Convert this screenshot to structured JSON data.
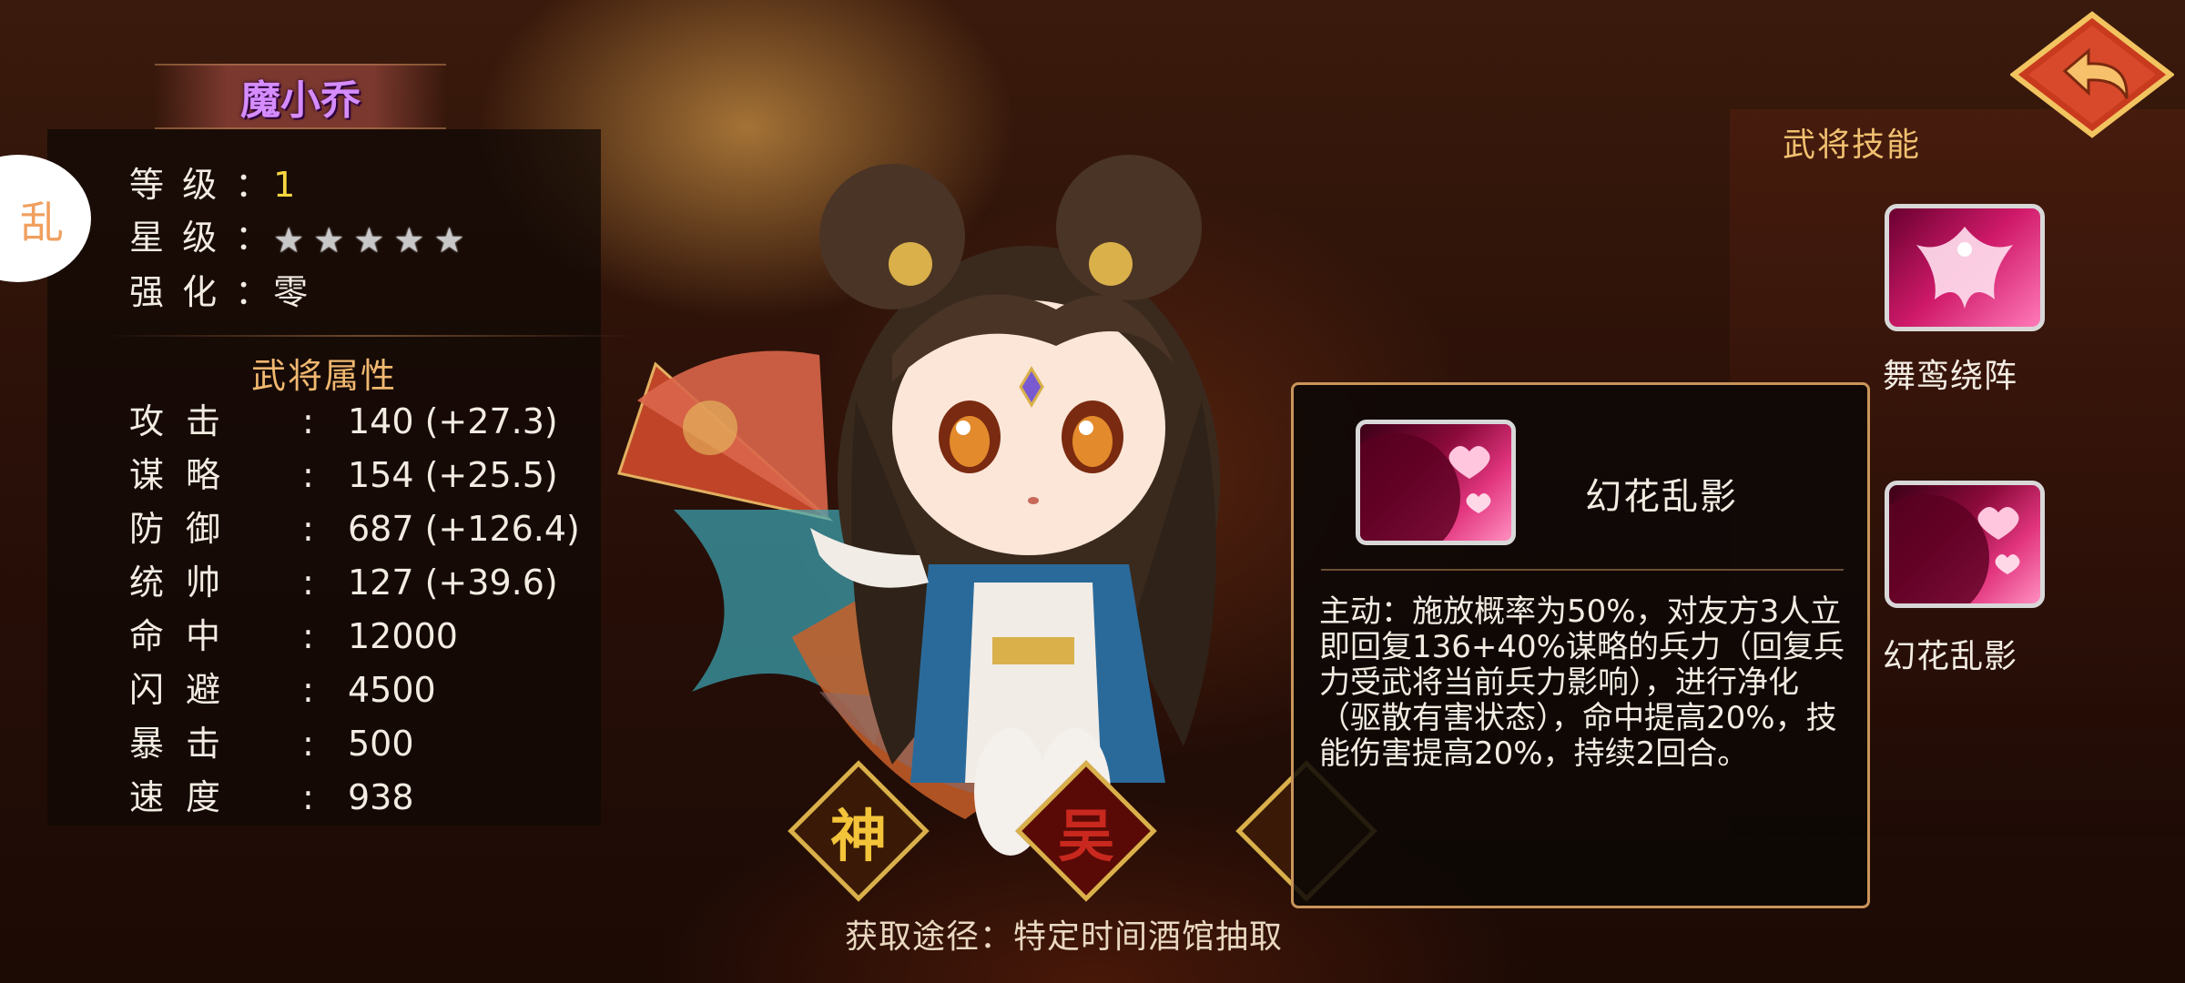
{
  "hero": {
    "name": "魔小乔",
    "level_label": "等 级 ：",
    "level_value": "1",
    "star_label": "星 级 ：",
    "stars": 5,
    "enhance_label": "强 化 ：",
    "enhance_value": "零",
    "side_badge_text": "乱"
  },
  "attributes": {
    "title": "武将属性",
    "rows": [
      {
        "label": "攻击",
        "value": "140 (+27.3)"
      },
      {
        "label": "谋略",
        "value": "154 (+25.5)"
      },
      {
        "label": "防御",
        "value": "687 (+126.4)"
      },
      {
        "label": "统帅",
        "value": "127 (+39.6)"
      },
      {
        "label": "命中",
        "value": "12000"
      },
      {
        "label": "闪避",
        "value": "4500"
      },
      {
        "label": "暴击",
        "value": "500"
      },
      {
        "label": "速度",
        "value": "938"
      }
    ]
  },
  "emblems": [
    {
      "char": "神",
      "color": "#f3c43a"
    },
    {
      "char": "吴",
      "color": "#c8281e"
    }
  ],
  "skill_popup": {
    "name": "幻花乱影",
    "description": "主动：施放概率为50%，对友方3人立即回复136+40%谋略的兵力（回复兵力受武将当前兵力影响），进行净化（驱散有害状态），命中提高20%，技能伤害提高20%，持续2回合。"
  },
  "skills_panel": {
    "title": "武将技能",
    "skills": [
      {
        "name": "舞鸾绕阵",
        "icon": "phoenix-icon"
      },
      {
        "name": "幻花乱影",
        "icon": "flower-hearts-icon"
      }
    ]
  },
  "source": "获取途径：特定时间酒馆抽取",
  "colors": {
    "name": "#d58cff",
    "level": "#f7d640",
    "accent": "#f0b870",
    "frame": "#c9955a"
  }
}
